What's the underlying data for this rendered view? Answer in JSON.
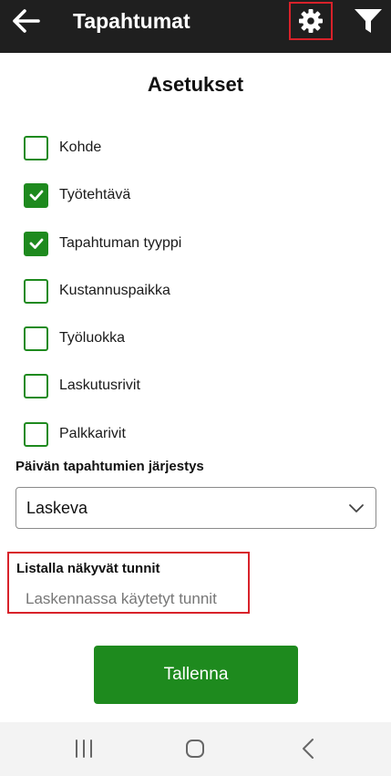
{
  "appbar": {
    "title": "Tapahtumat",
    "back_icon": "arrow-left-icon",
    "settings_icon": "gear-icon",
    "filter_icon": "filter-icon"
  },
  "page": {
    "title": "Asetukset"
  },
  "options": [
    {
      "label": "Kohde",
      "checked": false
    },
    {
      "label": "Työtehtävä",
      "checked": true
    },
    {
      "label": "Tapahtuman tyyppi",
      "checked": true
    },
    {
      "label": "Kustannuspaikka",
      "checked": false
    },
    {
      "label": "Työluokka",
      "checked": false
    },
    {
      "label": "Laskutusrivit",
      "checked": false
    },
    {
      "label": "Palkkarivit",
      "checked": false
    }
  ],
  "order": {
    "label": "Päivän tapahtumien järjestys",
    "selected": "Laskeva"
  },
  "hours": {
    "label": "Listalla näkyvät tunnit",
    "value": "Laskennassa käytetyt tunnit"
  },
  "save_label": "Tallenna",
  "colors": {
    "accent": "#1e8a1e",
    "highlight": "#d8222a",
    "appbar": "#1f1f1f"
  },
  "navbar": {
    "icons": [
      "recent-apps-icon",
      "home-icon",
      "back-icon"
    ]
  }
}
